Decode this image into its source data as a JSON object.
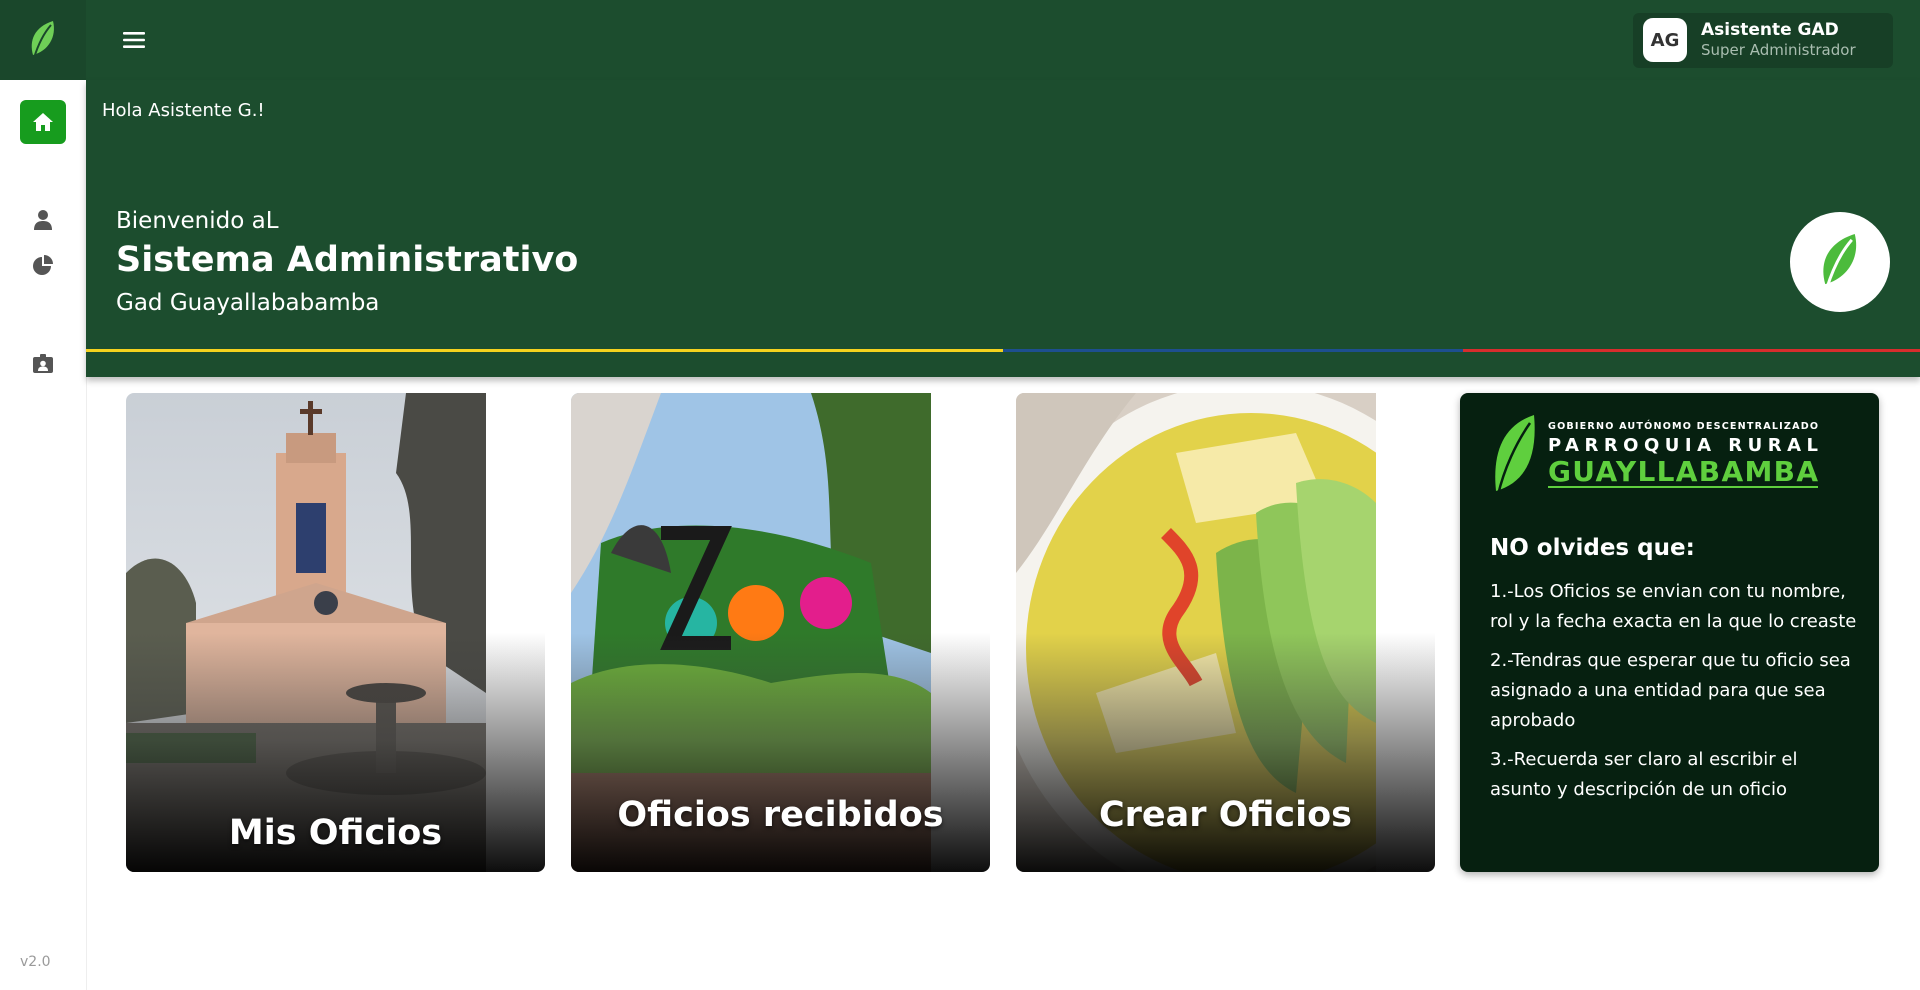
{
  "header": {
    "user": {
      "initials": "AG",
      "name": "Asistente GAD",
      "role": "Super Administrador"
    }
  },
  "sidebar": {
    "items": [
      {
        "icon": "home-icon",
        "active": true
      },
      {
        "icon": "user-icon",
        "active": false
      },
      {
        "icon": "pie-chart-icon",
        "active": false
      },
      {
        "icon": "id-badge-icon",
        "active": false
      }
    ],
    "version": "v2.0"
  },
  "hero": {
    "greeting": "Hola Asistente G.!",
    "welcome": "Bienvenido aL",
    "title": "Sistema Administrativo",
    "subtitle": "Gad Guayallababamba"
  },
  "cards": [
    {
      "label": "Mis Oficios",
      "image": "church-tower-plaza-photo"
    },
    {
      "label": "Oficios recibidos",
      "image": "quito-zoo-sign-photo"
    },
    {
      "label": "Crear Oficios",
      "image": "soup-avocado-photo"
    }
  ],
  "info": {
    "logo": {
      "line1": "GOBIERNO AUTÓNOMO DESCENTRALIZADO",
      "line2": "PARROQUIA RURAL",
      "line3": "GUAYLLABAMBA"
    },
    "heading": "NO olvides que:",
    "tips": [
      "1.-Los Oficios se envian con tu nombre, rol y la fecha exacta en la que lo creaste",
      "2.-Tendras que esperar que tu oficio sea asignado a una entidad para que sea aprobado",
      "3.-Recuerda ser claro al escribir el asunto y descripción de un oficio"
    ]
  },
  "colors": {
    "header_green": "#1c4d2e",
    "active_green": "#179c1e",
    "info_bg": "#062010",
    "flag_yellow": "#f4d21e",
    "flag_blue": "#1d4f8f",
    "flag_red": "#d72d2d"
  }
}
